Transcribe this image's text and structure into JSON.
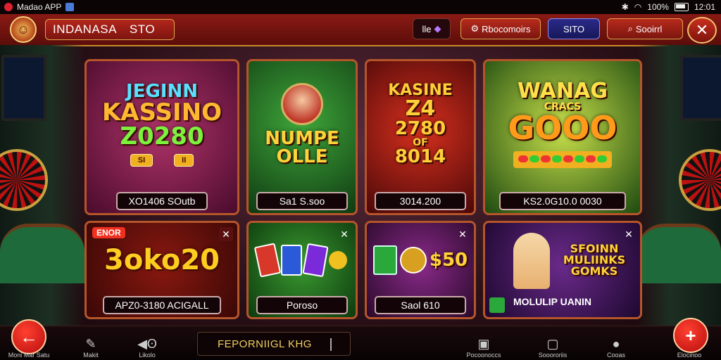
{
  "status_bar": {
    "app_name": "Madao APP",
    "battery": "100%",
    "time": "12:01"
  },
  "header": {
    "title": "INDANASA",
    "title_suffix": "STO",
    "btn_1": "lle",
    "btn_2": "Rbocomoirs",
    "btn_3": "SITO",
    "btn_4": "Sooirrl",
    "close": "✕"
  },
  "cards": [
    {
      "lines": [
        "JEGINN",
        "KASSINO",
        "Z0280"
      ],
      "pills": [
        "SI",
        "II"
      ],
      "label": "XO1406 SOutb"
    },
    {
      "lines": [
        "NUMPE",
        "OLLE"
      ],
      "label": "Sa1 S.soo"
    },
    {
      "lines": [
        "KASINE",
        "Z4",
        "2780",
        "OF",
        "8014"
      ],
      "label": "3014.200"
    },
    {
      "lines": [
        "WANAG",
        "CRACS",
        "GOOO"
      ],
      "label": "KS2.0G10.0 0030"
    },
    {
      "lines": [
        "3oko20"
      ],
      "tag": "ENOR",
      "label": "APZ0-3180 ACIGALL"
    },
    {
      "lines": [],
      "label": "Poroso"
    },
    {
      "lines": [
        "$50"
      ],
      "label": "Saol 610"
    },
    {
      "lines": [
        "SFOINN",
        "MULIINKS",
        "GOMKS"
      ],
      "label": "MOLULIP UANIN"
    }
  ],
  "bottom_nav": {
    "items": [
      "Moni Mar Satu",
      "Makit",
      "Likolo",
      "Pocoonoccs",
      "Sooororiis",
      "Cooas",
      "Elocinoo"
    ],
    "search_value": "FEPORNIIGL KHG"
  },
  "colors": {
    "accent": "#b5552a",
    "header": "#8a1a14",
    "gold": "#f3c25b"
  }
}
